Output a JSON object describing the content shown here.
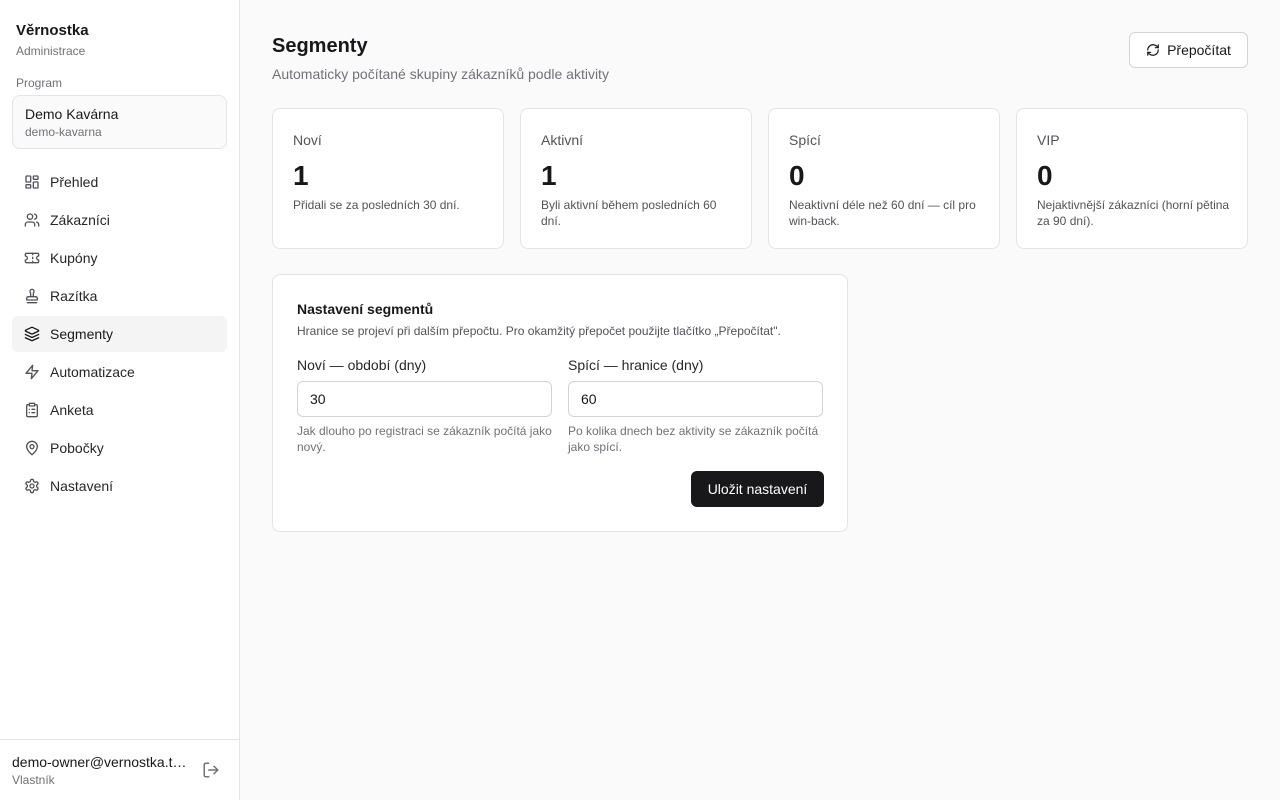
{
  "brand": {
    "title": "Věrnostka",
    "subtitle": "Administrace"
  },
  "program": {
    "label": "Program",
    "name": "Demo Kavárna",
    "slug": "demo-kavarna"
  },
  "nav": [
    {
      "label": "Přehled",
      "icon": "grid-icon"
    },
    {
      "label": "Zákazníci",
      "icon": "users-icon"
    },
    {
      "label": "Kupóny",
      "icon": "ticket-icon"
    },
    {
      "label": "Razítka",
      "icon": "stamp-icon"
    },
    {
      "label": "Segmenty",
      "icon": "layers-icon",
      "active": true
    },
    {
      "label": "Automatizace",
      "icon": "zap-icon"
    },
    {
      "label": "Anketa",
      "icon": "clipboard-icon"
    },
    {
      "label": "Pobočky",
      "icon": "map-pin-icon"
    },
    {
      "label": "Nastavení",
      "icon": "gear-icon"
    }
  ],
  "user": {
    "email": "demo-owner@vernostka.t…",
    "role": "Vlastník"
  },
  "header": {
    "title": "Segmenty",
    "subtitle": "Automaticky počítané skupiny zákazníků podle aktivity",
    "recalc_label": "Přepočítat"
  },
  "cards": [
    {
      "label": "Noví",
      "value": "1",
      "desc": "Přidali se za posledních 30 dní."
    },
    {
      "label": "Aktivní",
      "value": "1",
      "desc": "Byli aktivní během posledních 60 dní."
    },
    {
      "label": "Spící",
      "value": "0",
      "desc": "Neaktivní déle než 60 dní — cíl pro win-back."
    },
    {
      "label": "VIP",
      "value": "0",
      "desc": "Nejaktivnější zákazníci (horní pětina za 90 dní)."
    }
  ],
  "settings": {
    "title": "Nastavení segmentů",
    "desc": "Hranice se projeví při dalším přepočtu. Pro okamžitý přepočet použijte tlačítko „Přepočítat\".",
    "new_label": "Noví — období (dny)",
    "new_value": "30",
    "new_help": "Jak dlouho po registraci se zákazník počítá jako nový.",
    "sleep_label": "Spící — hranice (dny)",
    "sleep_value": "60",
    "sleep_help": "Po kolika dnech bez aktivity se zákazník počítá jako spící.",
    "save_label": "Uložit nastavení"
  },
  "colors": {
    "accent": "#18181b",
    "active_bg": "#f4f4f5",
    "border": "#e4e4e7",
    "muted": "#71717a"
  }
}
